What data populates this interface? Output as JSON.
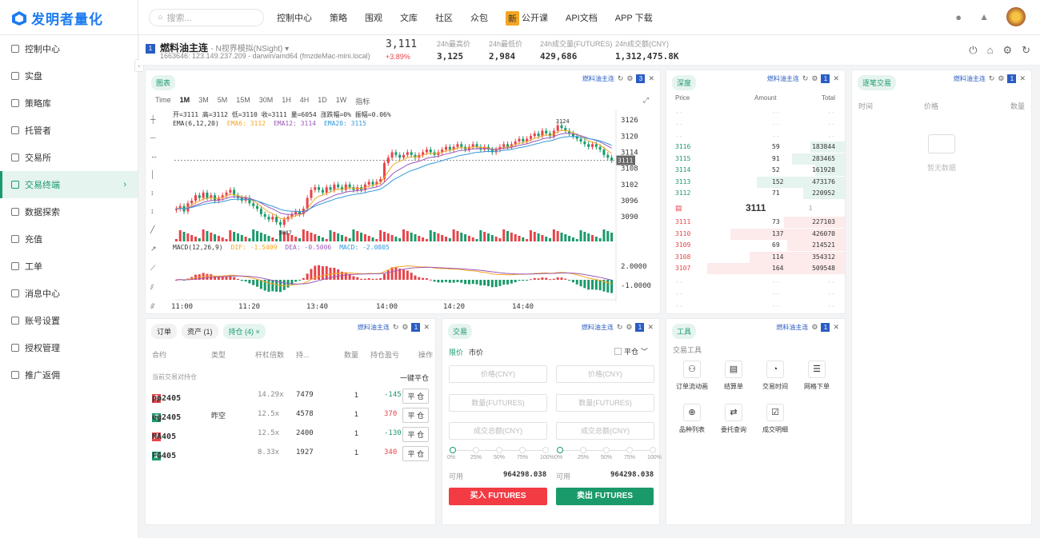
{
  "brand": {
    "name": "发明者量化"
  },
  "search": {
    "placeholder": "搜索..."
  },
  "nav": [
    "控制中心",
    "策略",
    "围观",
    "文库",
    "社区",
    "众包",
    "公开课",
    "API文档",
    "APP 下载"
  ],
  "nav_new_badge": "新",
  "sidebar": {
    "items": [
      "控制中心",
      "实盘",
      "策略库",
      "托管者",
      "交易所",
      "交易终端",
      "数据探索",
      "充值",
      "工单",
      "消息中心",
      "账号设置",
      "授权管理",
      "推广返佣"
    ],
    "active_index": 5
  },
  "info": {
    "badge": "1",
    "symbol": "燃料油主连",
    "mode": "- N视界模拟(NSight) ▾",
    "sub": "1663646: 123.149.237.209 - darwin/amd64 (fmzdeMac-mini.local)",
    "price": "3,111",
    "change": "+3.89%",
    "quotes": [
      {
        "label": "24h最高价",
        "value": "3,125"
      },
      {
        "label": "24h最低价",
        "value": "2,984"
      },
      {
        "label": "24h成交量(FUTURES)",
        "value": "429,686"
      },
      {
        "label": "24h成交额(CNY)",
        "value": "1,312,475.8K"
      }
    ]
  },
  "chart_panel": {
    "tag": "图表",
    "src": "燃料油主连",
    "num": "3",
    "timeframes": [
      "Time",
      "1M",
      "3M",
      "5M",
      "15M",
      "30M",
      "1H",
      "4H",
      "1D",
      "1W",
      "指标"
    ],
    "active_tf": "1M",
    "ohlc": "开=3111 高=3112 低=3110 收=3111 量=6054 涨跌幅=0% 振幅=0.06%",
    "ema_label": "EMA(6,12,20)",
    "ema6": "EMA6: 3112",
    "ema12": "EMA12: 3114",
    "ema20": "EMA20: 3115",
    "macd_label": "MACD(12,26,9)",
    "dif": "DIF: -1.5409",
    "dea": "DEA: -0.5006",
    "macd": "MACD: -2.0805",
    "high_mark": "3124",
    "low_mark": "3087",
    "last_tag": "3111"
  },
  "chart_data": {
    "type": "candlestick",
    "y_ticks": [
      "3126",
      "3120",
      "3114",
      "3108",
      "3102",
      "3096",
      "3090"
    ],
    "macd_ticks": [
      "2.0000",
      "-1.0000"
    ],
    "x_ticks": [
      "11:00",
      "11:20",
      "13:40",
      "14:00",
      "14:20",
      "14:40"
    ],
    "ylim": [
      3085,
      3129
    ],
    "close": [
      3093,
      3094,
      3092,
      3095,
      3096,
      3098,
      3097,
      3099,
      3097,
      3098,
      3096,
      3097,
      3098,
      3099,
      3100,
      3098,
      3097,
      3096,
      3097,
      3095,
      3094,
      3093,
      3091,
      3090,
      3089,
      3090,
      3088,
      3087,
      3089,
      3090,
      3091,
      3092,
      3091,
      3093,
      3097,
      3100,
      3101,
      3100,
      3099,
      3101,
      3100,
      3102,
      3101,
      3100,
      3102,
      3101,
      3100,
      3101,
      3100,
      3102,
      3103,
      3102,
      3103,
      3104,
      3110,
      3112,
      3114,
      3113,
      3112,
      3113,
      3114,
      3113,
      3112,
      3113,
      3114,
      3115,
      3114,
      3113,
      3114,
      3115,
      3116,
      3115,
      3116,
      3117,
      3116,
      3115,
      3116,
      3117,
      3116,
      3115,
      3116,
      3115,
      3114,
      3115,
      3116,
      3117,
      3116,
      3117,
      3118,
      3119,
      3118,
      3119,
      3120,
      3121,
      3120,
      3122,
      3121,
      3120,
      3122,
      3124,
      3123,
      3122,
      3121,
      3120,
      3119,
      3118,
      3117,
      3116,
      3117,
      3116,
      3115,
      3113,
      3112,
      3111
    ]
  },
  "depth": {
    "tag": "深度",
    "src": "燃料油主连",
    "num": "1",
    "headers": [
      "Price",
      "Amount",
      "Total"
    ],
    "bids": [
      {
        "p": "3116",
        "a": "59",
        "t": "183844",
        "r": 0.36
      },
      {
        "p": "3115",
        "a": "91",
        "t": "283465",
        "r": 0.55
      },
      {
        "p": "3114",
        "a": "52",
        "t": "161928",
        "r": 0.31
      },
      {
        "p": "3113",
        "a": "152",
        "t": "473176",
        "r": 0.92
      },
      {
        "p": "3112",
        "a": "71",
        "t": "220952",
        "r": 0.43
      }
    ],
    "mid": "3111",
    "mid_sel": "1",
    "asks": [
      {
        "p": "3111",
        "a": "73",
        "t": "227103",
        "r": 0.44
      },
      {
        "p": "3110",
        "a": "137",
        "t": "426070",
        "r": 0.83
      },
      {
        "p": "3109",
        "a": "69",
        "t": "214521",
        "r": 0.42
      },
      {
        "p": "3108",
        "a": "114",
        "t": "354312",
        "r": 0.69
      },
      {
        "p": "3107",
        "a": "164",
        "t": "509548",
        "r": 1.0
      }
    ]
  },
  "trades": {
    "tag": "逐笔交易",
    "src": "燃料油主连",
    "num": "1",
    "headers": [
      "时间",
      "价格",
      "数量"
    ],
    "empty": "暂无数据"
  },
  "orders": {
    "tabs": [
      "订单",
      "资产 (1)",
      "持仓 (4) ×"
    ],
    "src": "燃料油主连",
    "num": "1",
    "headers": [
      "合约",
      "类型",
      "杆杠倍数",
      "持...",
      "数量",
      "持仓盈亏",
      "操作"
    ],
    "caption": "当前交易对持仓",
    "close_all": "一键平仓",
    "rows": [
      {
        "dir": "多",
        "name": "pp2405",
        "type": "",
        "lev": "14.29x",
        "hold": "7479",
        "qty": "1",
        "pnl": "-145",
        "btn": "平 仓"
      },
      {
        "dir": "空",
        "name": "eg2405",
        "type": "昨空",
        "lev": "12.5x",
        "hold": "4578",
        "qty": "1",
        "pnl": "370",
        "btn": "平 仓"
      },
      {
        "dir": "多",
        "name": "MA405",
        "type": "",
        "lev": "12.5x",
        "hold": "2400",
        "qty": "1",
        "pnl": "-130",
        "btn": "平 仓"
      },
      {
        "dir": "空",
        "name": "FG405",
        "type": "",
        "lev": "8.33x",
        "hold": "1927",
        "qty": "1",
        "pnl": "340",
        "btn": "平 仓"
      }
    ]
  },
  "trade": {
    "tag": "交易",
    "src": "燃料油主连",
    "num": "1",
    "order_types": [
      "限价",
      "市价"
    ],
    "close_opt": "平仓",
    "price_ph": "价格(CNY)",
    "amount_ph": "数量(FUTURES)",
    "total_ph": "成交总额(CNY)",
    "pcts": [
      "0%",
      "25%",
      "50%",
      "75%",
      "100%"
    ],
    "avail_label": "可用",
    "avail": "964298.038",
    "buy": "买入 FUTURES",
    "sell": "卖出 FUTURES"
  },
  "tools": {
    "tag": "工具",
    "src": "燃料油主连",
    "num": "1",
    "title": "交易工具",
    "items": [
      "订单流动画",
      "结算单",
      "交易时间",
      "网格下单",
      "品种列表",
      "委托查询",
      "成交明细"
    ]
  }
}
